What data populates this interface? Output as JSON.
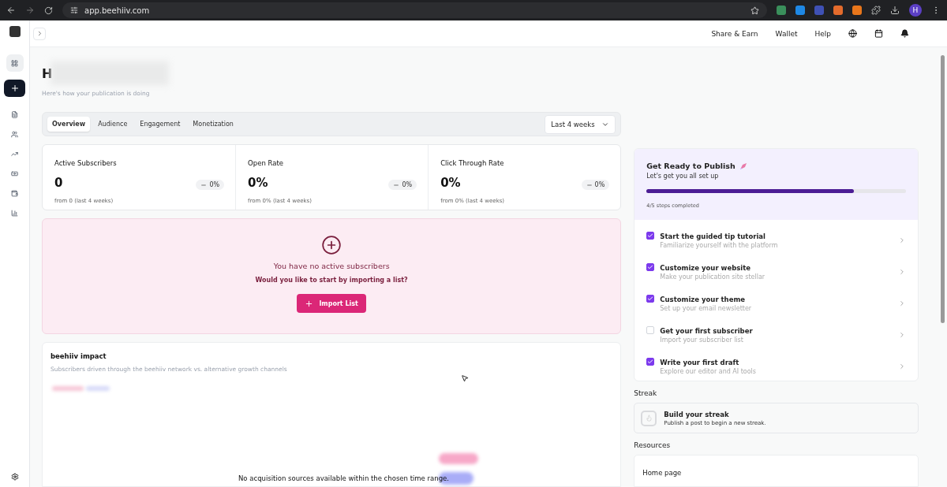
{
  "browser": {
    "url": "app.beehiiv.com",
    "profile_initial": "H"
  },
  "topbar": {
    "links": [
      "Share & Earn",
      "Wallet",
      "Help"
    ]
  },
  "sidebar": {
    "items": [
      {
        "kind": "grid",
        "selected": true
      },
      {
        "kind": "doc",
        "selected": false
      },
      {
        "kind": "people",
        "selected": false
      },
      {
        "kind": "trend",
        "selected": false
      },
      {
        "kind": "money",
        "selected": false
      },
      {
        "kind": "wallet",
        "selected": false
      },
      {
        "kind": "chart",
        "selected": false
      }
    ]
  },
  "header": {
    "title": "H",
    "subtitle": "Here's how your publication is doing"
  },
  "tabs": [
    {
      "label": "Overview",
      "selected": true
    },
    {
      "label": "Audience",
      "selected": false
    },
    {
      "label": "Engagement",
      "selected": false
    },
    {
      "label": "Monetization",
      "selected": false
    }
  ],
  "range": {
    "value": "Last 4 weeks"
  },
  "stats": [
    {
      "label": "Active Subscribers",
      "value": "0",
      "change": "0%",
      "note": "from 0 (last 4 weeks)"
    },
    {
      "label": "Open Rate",
      "value": "0%",
      "change": "0%",
      "note": "from 0% (last 4 weeks)"
    },
    {
      "label": "Click Through Rate",
      "value": "0%",
      "change": "0%",
      "note": "from 0% (last 4 weeks)"
    }
  ],
  "empty_state": {
    "title": "You have no active subscribers",
    "subtitle": "Would you like to start by importing a list?",
    "button": "Import List"
  },
  "impact": {
    "title": "beehiiv impact",
    "subtitle": "Subscribers driven through the beehiiv network vs. alternative growth channels",
    "message": "No acquisition sources available within the chosen time range."
  },
  "publish": {
    "title": "Get Ready to Publish",
    "subtitle": "Let's get you all set up",
    "level": 0.8,
    "progress_text": "4/5 steps completed",
    "steps": [
      {
        "title": "Start the guided tip tutorial",
        "desc": "Familiarize yourself with the platform",
        "checked": true
      },
      {
        "title": "Customize your website",
        "desc": "Make your publication site stellar",
        "checked": true
      },
      {
        "title": "Customize your theme",
        "desc": "Set up your email newsletter",
        "checked": true
      },
      {
        "title": "Get your first subscriber",
        "desc": "Import your subscriber list",
        "checked": false
      },
      {
        "title": "Write your first draft",
        "desc": "Explore our editor and AI tools",
        "checked": true
      }
    ]
  },
  "streak": {
    "heading": "Streak",
    "title": "Build your streak",
    "desc": "Publish a post to begin a new streak."
  },
  "resources": {
    "heading": "Resources",
    "items": [
      "Home page"
    ]
  }
}
